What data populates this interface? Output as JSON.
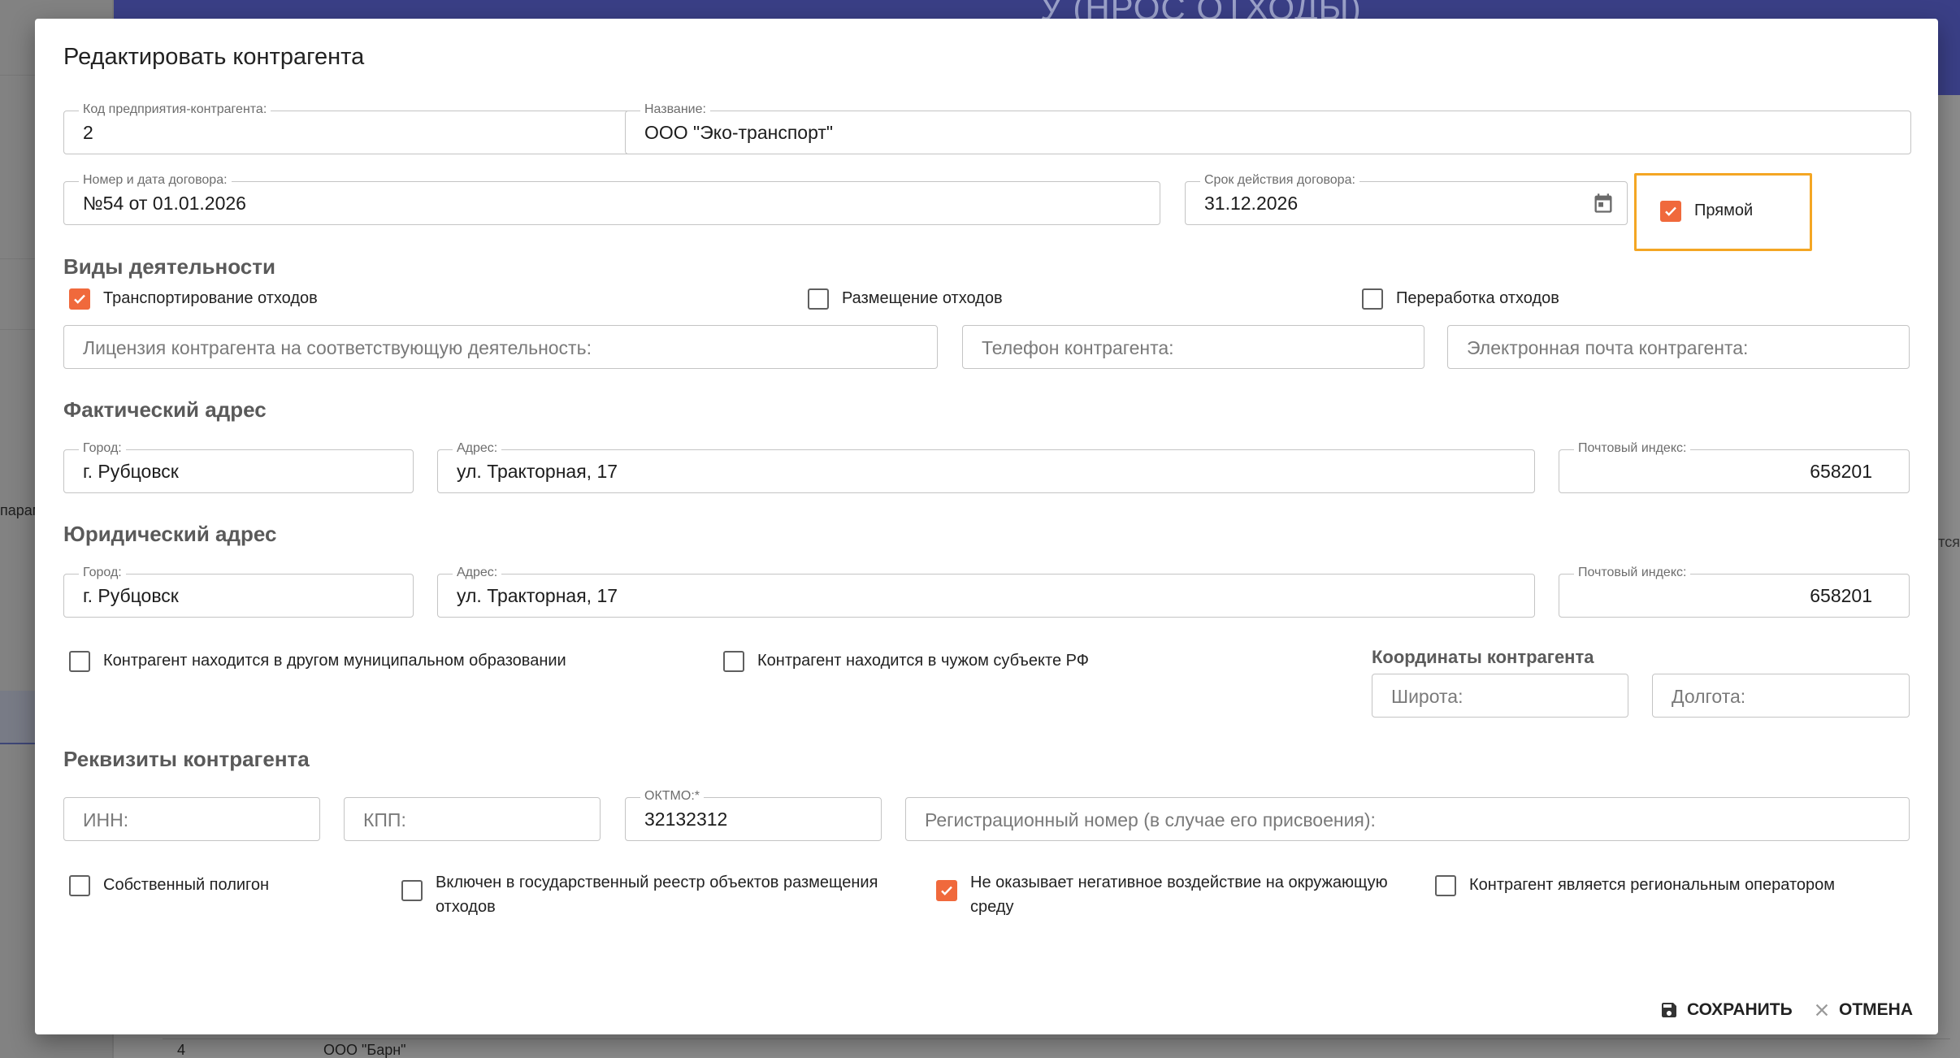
{
  "background": {
    "header_title": "У      (НРОС ОТХОДЫ)",
    "side_fragment": "парам",
    "right_fragment": "ется",
    "row": {
      "num": "4",
      "name": "ООО \"Барн\""
    }
  },
  "dialog": {
    "title": "Редактировать контрагента",
    "fields": {
      "code": {
        "label": "Код предприятия-контрагента:",
        "value": "2"
      },
      "name": {
        "label": "Название:",
        "value": "ООО \"Эко-транспорт\""
      },
      "contract": {
        "label": "Номер и дата договора:",
        "value": "№54 от 01.01.2026"
      },
      "contract_term": {
        "label": "Срок действия договора:",
        "value": "31.12.2026"
      }
    },
    "direct_checkbox": {
      "label": "Прямой",
      "checked": true
    },
    "activity": {
      "title": "Виды деятельности",
      "items": [
        {
          "label": "Транспортирование отходов",
          "checked": true
        },
        {
          "label": "Размещение отходов",
          "checked": false
        },
        {
          "label": "Переработка отходов",
          "checked": false
        }
      ],
      "license_placeholder": "Лицензия контрагента на соответствующую деятельность:",
      "phone_placeholder": "Телефон контрагента:",
      "email_placeholder": "Электронная почта контрагента:"
    },
    "actual_address": {
      "title": "Фактический адрес",
      "city_label": "Город:",
      "city": "г. Рубцовск",
      "address_label": "Адрес:",
      "address": "ул. Тракторная, 17",
      "zip_label": "Почтовый индекс:",
      "zip": "658201"
    },
    "legal_address": {
      "title": "Юридический адрес",
      "city_label": "Город:",
      "city": "г. Рубцовск",
      "address_label": "Адрес:",
      "address": "ул. Тракторная, 17",
      "zip_label": "Почтовый индекс:",
      "zip": "658201"
    },
    "location_flags": [
      {
        "label": "Контрагент находится в другом муниципальном образовании",
        "checked": false
      },
      {
        "label": "Контрагент находится в чужом субъекте РФ",
        "checked": false
      }
    ],
    "coordinates": {
      "title": "Координаты контрагента",
      "lat_placeholder": "Широта:",
      "lon_placeholder": "Долгота:"
    },
    "requisites": {
      "title": "Реквизиты контрагента",
      "inn_placeholder": "ИНН:",
      "kpp_placeholder": "КПП:",
      "oktmo_label": "ОКТМО:*",
      "oktmo": "32132312",
      "reg_placeholder": "Регистрационный номер (в случае его присвоения):"
    },
    "flags": [
      {
        "label": "Собственный полигон",
        "checked": false
      },
      {
        "label_line1": "Включен в государственный реестр объектов размещения",
        "label_line2": "отходов",
        "checked": false
      },
      {
        "label_line1": "Не оказывает негативное воздействие на окружающую",
        "label_line2": "среду",
        "checked": true
      },
      {
        "label": "Контрагент является региональным оператором",
        "checked": false
      }
    ],
    "buttons": {
      "save": "СОХРАНИТЬ",
      "cancel": "ОТМЕНА"
    },
    "colors": {
      "accent": "#f0693c",
      "highlight": "#f4a623",
      "header": "#3a3f86"
    },
    "icons": {
      "calendar": "calendar-icon",
      "save": "floppy-disk-icon",
      "cancel": "close-icon",
      "check": "checkmark-icon"
    }
  }
}
